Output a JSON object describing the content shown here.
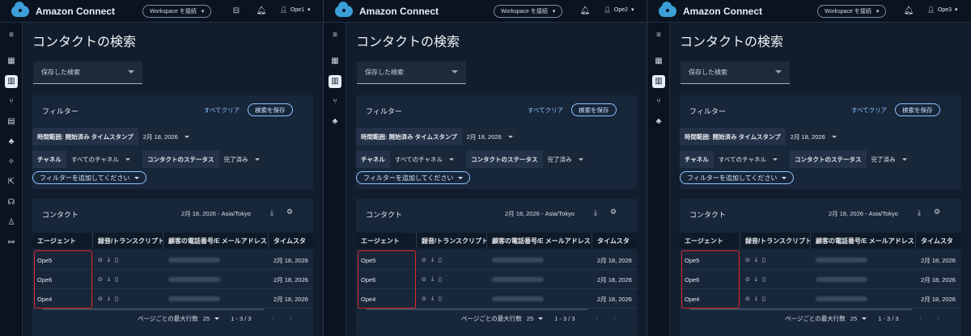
{
  "app": {
    "name": "Amazon Connect",
    "workspace_label": "Workspace を接続"
  },
  "page": {
    "title": "コンタクトの検索",
    "saved_search_placeholder": "保存した検索"
  },
  "filters": {
    "title": "フィルター",
    "clear_all": "すべてクリア",
    "save_search": "検索を保存",
    "time_range_key": "時間範囲: 開始済み タイムスタンプ",
    "time_range_value": "2月 18, 2026",
    "channel_key": "チャネル",
    "channel_value": "すべてのチャネル",
    "status_key": "コンタクトのステータス",
    "status_value": "完了済み",
    "add_filter": "フィルターを追加してください"
  },
  "contacts": {
    "title": "コンタクト",
    "date_tz": "2月 18, 2026 - Asia/Tokyo",
    "columns": [
      "エージェント",
      "録音/トランスクリプト",
      "顧客の電話番号/E メールアドレス",
      "タイムスタンプ"
    ],
    "columns_short": [
      "エージェント",
      "録音/トランスクリプト",
      "顧客の電話番号/E メールアドレス",
      "タイムスタ"
    ],
    "rows": [
      {
        "agent": "Ope5",
        "timestamp": "2月 18, 2026"
      },
      {
        "agent": "Ope6",
        "timestamp": "2月 18, 2026"
      },
      {
        "agent": "Ope4",
        "timestamp": "2月 18, 2026"
      }
    ],
    "rows_per_page_label": "ページごとの最大行数",
    "rows_per_page_value": "25",
    "range": "1 - 3 / 3"
  },
  "panels": [
    {
      "user": "Ope1"
    },
    {
      "user": "Ope2"
    },
    {
      "user": "Ope3"
    }
  ],
  "colors": {
    "accent": "#8ec5ff",
    "highlight": "#e02828",
    "logo": "#3aa0d7"
  }
}
